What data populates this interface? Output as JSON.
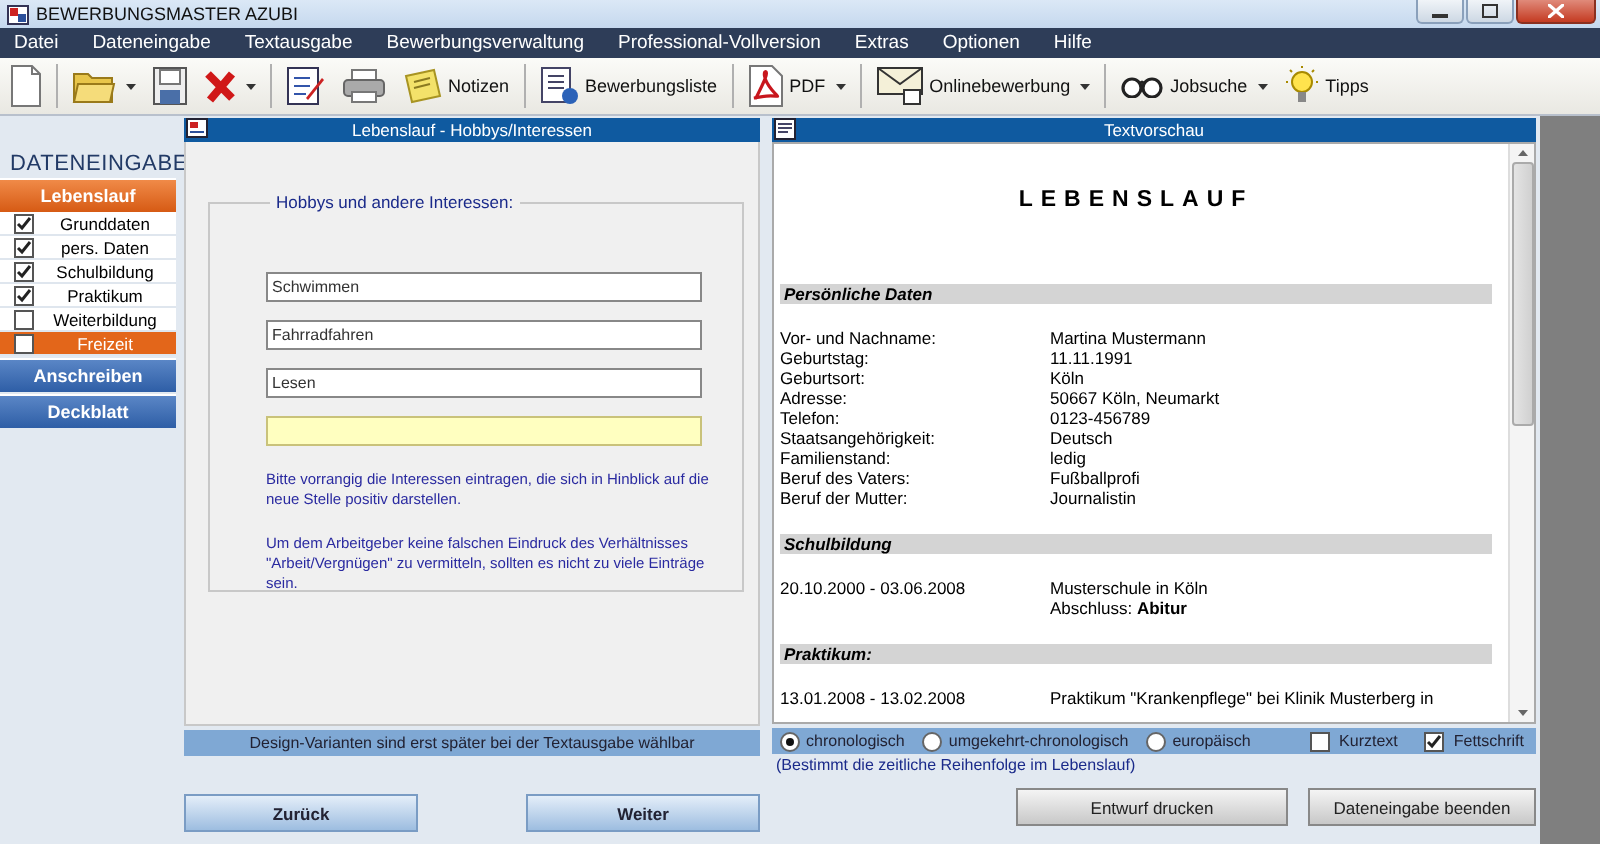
{
  "window": {
    "title": "BEWERBUNGSMASTER AZUBI"
  },
  "menu": [
    "Datei",
    "Dateneingabe",
    "Textausgabe",
    "Bewerbungsverwaltung",
    "Professional-Vollversion",
    "Extras",
    "Optionen",
    "Hilfe"
  ],
  "toolbar": [
    {
      "kind": "new"
    },
    {
      "kind": "separator"
    },
    {
      "kind": "open",
      "dropdown": true
    },
    {
      "kind": "save"
    },
    {
      "kind": "delete",
      "dropdown": true
    },
    {
      "kind": "separator"
    },
    {
      "kind": "edit"
    },
    {
      "kind": "print"
    },
    {
      "kind": "notes",
      "label": "Notizen"
    },
    {
      "kind": "separator"
    },
    {
      "kind": "list",
      "label": "Bewerbungsliste"
    },
    {
      "kind": "separator"
    },
    {
      "kind": "pdf",
      "label": "PDF",
      "dropdown": true
    },
    {
      "kind": "separator"
    },
    {
      "kind": "mail",
      "label": "Onlinebewerbung",
      "dropdown": true
    },
    {
      "kind": "separator"
    },
    {
      "kind": "glasses",
      "label": "Jobsuche",
      "dropdown": true
    },
    {
      "kind": "bulb",
      "label": "Tipps"
    }
  ],
  "sidebar": {
    "heading": "DATENEINGABE",
    "items": [
      {
        "kind": "section",
        "label": "Lebenslauf",
        "selected": true
      },
      {
        "kind": "check",
        "label": "Grunddaten",
        "checked": true,
        "selected": false
      },
      {
        "kind": "check",
        "label": "pers. Daten",
        "checked": true,
        "selected": false
      },
      {
        "kind": "check",
        "label": "Schulbildung",
        "checked": true,
        "selected": false
      },
      {
        "kind": "check",
        "label": "Praktikum",
        "checked": true,
        "selected": false
      },
      {
        "kind": "check",
        "label": "Weiterbildung",
        "checked": false,
        "selected": false
      },
      {
        "kind": "check",
        "label": "Freizeit",
        "checked": false,
        "selected": true
      },
      {
        "kind": "section",
        "label": "Anschreiben",
        "selected": false
      },
      {
        "kind": "section",
        "label": "Deckblatt",
        "selected": false
      }
    ]
  },
  "form": {
    "title": "Lebenslauf - Hobbys/Interessen",
    "legend": "Hobbys und andere Interessen:",
    "fields": [
      {
        "value": "Schwimmen",
        "focused": false
      },
      {
        "value": "Fahrradfahren",
        "focused": false
      },
      {
        "value": "Lesen",
        "focused": false
      },
      {
        "focused": true
      }
    ],
    "hints": [
      "Bitte vorrangig die Interessen eintragen, die sich in Hinblick auf die neue Stelle positiv darstellen.",
      "Um dem Arbeitgeber keine falschen Eindruck des Verhältnisses \"Arbeit/Vergnügen\" zu vermitteln, sollten es nicht zu viele Einträge sein."
    ],
    "footer_note": "Design-Varianten sind erst später bei der Textausgabe wählbar",
    "buttons": [
      "Zurück",
      "Weiter"
    ]
  },
  "preview": {
    "title": "Textvorschau",
    "doc_title": "LEBENSLAUF",
    "sections": [
      {
        "heading": "Persönliche Daten",
        "rows": [
          {
            "label": "Vor- und Nachname:",
            "lines": [
              "Martina Mustermann"
            ]
          },
          {
            "label": "Geburtstag:",
            "lines": [
              "11.11.1991"
            ]
          },
          {
            "label": "Geburtsort:",
            "lines": [
              "Köln"
            ]
          },
          {
            "label": "Adresse:",
            "lines": [
              "50667 Köln, Neumarkt"
            ]
          },
          {
            "label": "Telefon:",
            "lines": [
              "0123-456789"
            ]
          },
          {
            "label": "Staatsangehörigkeit:",
            "lines": [
              "Deutsch"
            ]
          },
          {
            "label": "Familienstand:",
            "lines": [
              "ledig"
            ]
          },
          {
            "label": "Beruf des Vaters:",
            "lines": [
              "Fußballprofi"
            ]
          },
          {
            "label": "Beruf der Mutter:",
            "lines": [
              "Journalistin"
            ]
          }
        ]
      },
      {
        "heading": "Schulbildung",
        "rows": [
          {
            "label": "20.10.2000 - 03.06.2008",
            "lines": [
              "Musterschule in Köln",
              "Abschluss: **Abitur**"
            ]
          }
        ]
      },
      {
        "heading": "Praktikum:",
        "rows": [
          {
            "label": "13.01.2008 - 13.02.2008",
            "lines": [
              "Praktikum \"Krankenpflege\" bei Klinik Musterberg in"
            ]
          }
        ]
      }
    ],
    "order_options": [
      {
        "label": "chronologisch",
        "selected": true
      },
      {
        "label": "umgekehrt-chronologisch",
        "selected": false
      },
      {
        "label": "europäisch",
        "selected": false
      }
    ],
    "text_options": [
      {
        "label": "Kurztext",
        "checked": false
      },
      {
        "label": "Fettschrift",
        "checked": true
      }
    ],
    "order_hint": "(Bestimmt die zeitliche Reihenfolge im Lebenslauf)",
    "buttons": [
      "Entwurf drucken",
      "Dateneingabe beenden"
    ]
  }
}
